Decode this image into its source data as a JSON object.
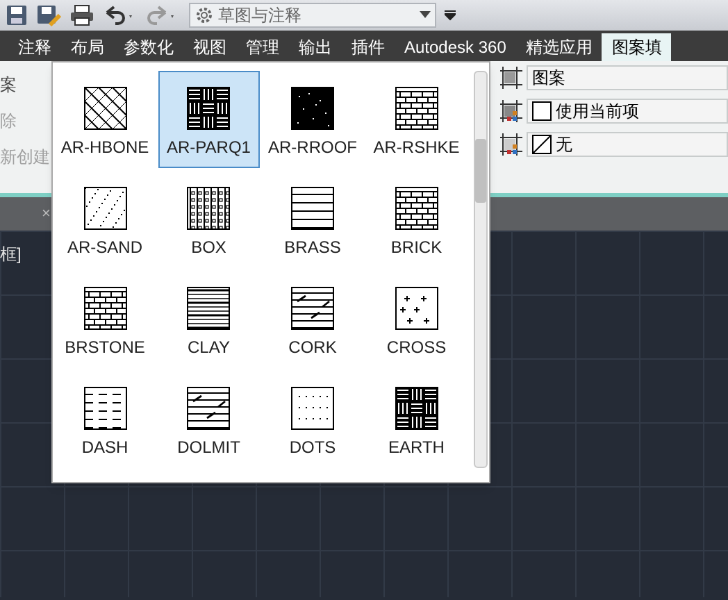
{
  "quick_access": {
    "workspace": "草图与注释"
  },
  "ribbon_tabs": [
    {
      "label": "注释",
      "selected": false
    },
    {
      "label": "布局",
      "selected": false
    },
    {
      "label": "参数化",
      "selected": false
    },
    {
      "label": "视图",
      "selected": false
    },
    {
      "label": "管理",
      "selected": false
    },
    {
      "label": "输出",
      "selected": false
    },
    {
      "label": "插件",
      "selected": false
    },
    {
      "label": "Autodesk 360",
      "selected": false
    },
    {
      "label": "精选应用",
      "selected": false
    },
    {
      "label": "图案填",
      "selected": true
    }
  ],
  "ribbon_left": [
    {
      "label": "案",
      "disabled": false
    },
    {
      "label": "除",
      "disabled": true
    },
    {
      "label": "新创建",
      "disabled": true
    }
  ],
  "file_tab_close": "×",
  "canvas_label": "框]",
  "pattern_gallery": [
    {
      "label": "AR-HBONE",
      "selected": false
    },
    {
      "label": "AR-PARQ1",
      "selected": true
    },
    {
      "label": "AR-RROOF",
      "selected": false
    },
    {
      "label": "AR-RSHKE",
      "selected": false
    },
    {
      "label": "AR-SAND",
      "selected": false
    },
    {
      "label": "BOX",
      "selected": false
    },
    {
      "label": "BRASS",
      "selected": false
    },
    {
      "label": "BRICK",
      "selected": false
    },
    {
      "label": "BRSTONE",
      "selected": false
    },
    {
      "label": "CLAY",
      "selected": false
    },
    {
      "label": "CORK",
      "selected": false
    },
    {
      "label": "CROSS",
      "selected": false
    },
    {
      "label": "DASH",
      "selected": false
    },
    {
      "label": "DOLMIT",
      "selected": false
    },
    {
      "label": "DOTS",
      "selected": false
    },
    {
      "label": "EARTH",
      "selected": false
    }
  ],
  "properties": [
    {
      "kind": "pattern",
      "value": "图案"
    },
    {
      "kind": "color",
      "value": "使用当前项"
    },
    {
      "kind": "background",
      "value": "无"
    }
  ]
}
